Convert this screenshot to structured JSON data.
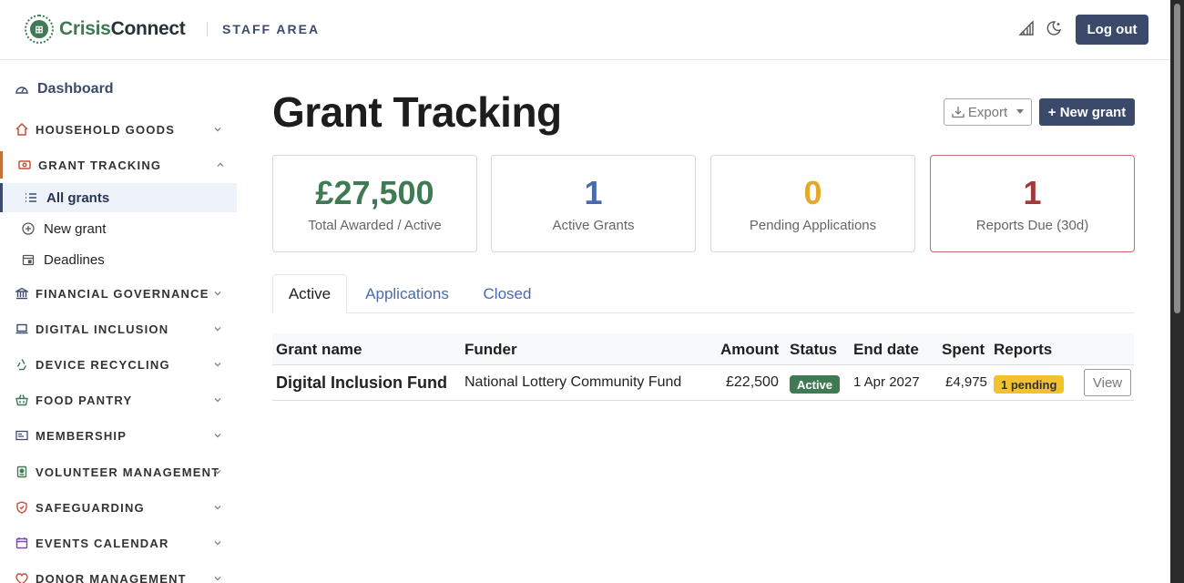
{
  "header": {
    "logo_part1": "Crisis",
    "logo_part2": "Connect",
    "staff_area": "STAFF AREA",
    "logout_label": "Log out"
  },
  "sidebar": {
    "dashboard": "Dashboard",
    "sections": [
      {
        "label": "HOUSEHOLD GOODS",
        "icon": "house-icon"
      },
      {
        "label": "GRANT TRACKING",
        "icon": "cash-icon"
      },
      {
        "label": "FINANCIAL GOVERNANCE",
        "icon": "bank-icon"
      },
      {
        "label": "DIGITAL INCLUSION",
        "icon": "laptop-icon"
      },
      {
        "label": "DEVICE RECYCLING",
        "icon": "recycle-icon"
      },
      {
        "label": "FOOD PANTRY",
        "icon": "basket-icon"
      },
      {
        "label": "MEMBERSHIP",
        "icon": "id-card-icon"
      },
      {
        "label": "VOLUNTEER MANAGEMENT",
        "icon": "badge-icon"
      },
      {
        "label": "SAFEGUARDING",
        "icon": "shield-icon"
      },
      {
        "label": "EVENTS CALENDAR",
        "icon": "calendar-icon"
      },
      {
        "label": "DONOR MANAGEMENT",
        "icon": "heart-icon"
      }
    ],
    "grant_subitems": [
      {
        "label": "All grants",
        "icon": "list-icon"
      },
      {
        "label": "New grant",
        "icon": "plus-circle-icon"
      },
      {
        "label": "Deadlines",
        "icon": "calendar-event-icon"
      }
    ]
  },
  "main": {
    "title": "Grant Tracking",
    "export_label": "Export",
    "new_grant_label": "+ New grant",
    "stats": [
      {
        "value": "£27,500",
        "caption": "Total Awarded / Active",
        "color": "#3f7a55"
      },
      {
        "value": "1",
        "caption": "Active Grants",
        "color": "#4a6ab0"
      },
      {
        "value": "0",
        "caption": "Pending Applications",
        "color": "#e2a92a"
      },
      {
        "value": "1",
        "caption": "Reports Due (30d)",
        "color": "#a33a3a"
      }
    ],
    "tabs": [
      "Active",
      "Applications",
      "Closed"
    ],
    "table": {
      "headers": [
        "Grant name",
        "Funder",
        "Amount",
        "Status",
        "End date",
        "Spent",
        "Reports"
      ],
      "rows": [
        {
          "name": "Digital Inclusion Fund",
          "funder": "National Lottery Community Fund",
          "amount": "£22,500",
          "status": "Active",
          "end_date": "1 Apr 2027",
          "spent": "£4,975",
          "reports": "1 pending",
          "action": "View"
        }
      ]
    }
  }
}
